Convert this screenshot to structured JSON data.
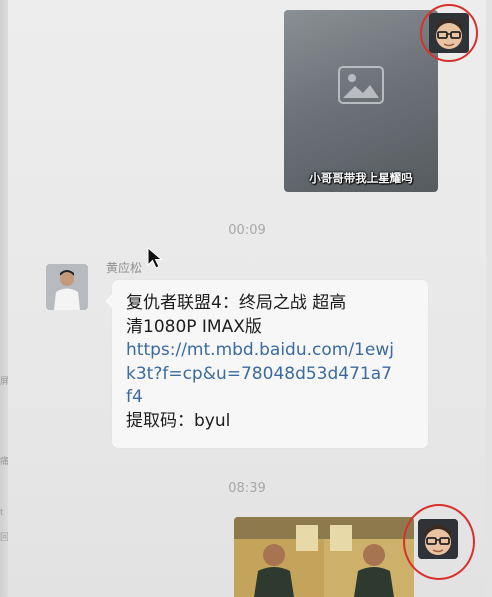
{
  "messages": [
    {
      "type": "image",
      "side": "right",
      "sender": "self",
      "caption": "小哥哥带我上星耀吗"
    },
    {
      "type": "timestamp",
      "text": "00:09"
    },
    {
      "type": "text",
      "side": "left",
      "sender_name": "黄应松",
      "lines": [
        "复仇者联盟4：终局之战 超高",
        "清1080P IMAX版",
        "https://mt.mbd.baidu.com/1ewj",
        "k3t?f=cp&u=78048d53d471a7",
        "f4",
        "提取码：byul"
      ]
    },
    {
      "type": "timestamp",
      "text": "08:39"
    },
    {
      "type": "video",
      "side": "right",
      "sender": "self"
    }
  ],
  "left_edge_chars": [
    "屏",
    "痛",
    "t",
    "回"
  ],
  "colors": {
    "chat_background": "#ededed",
    "bubble_background": "#f7f7f7",
    "link": "#3b6a9e",
    "timestamp": "#a7a7a7",
    "highlight_ring": "#d9302c"
  },
  "icons": [
    "mouse-pointer-icon"
  ]
}
